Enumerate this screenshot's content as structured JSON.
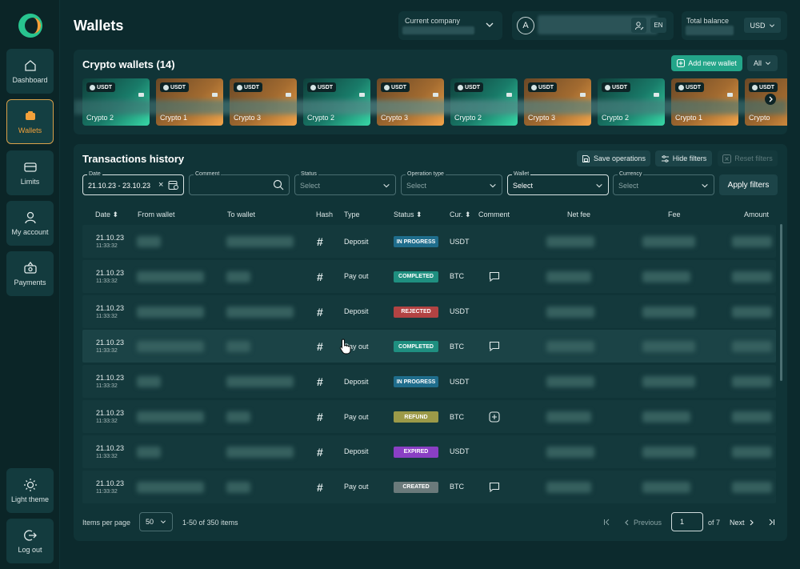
{
  "page": {
    "title": "Wallets"
  },
  "sidebar": {
    "items": [
      {
        "label": "Dashboard",
        "icon": "home-icon"
      },
      {
        "label": "Wallets",
        "icon": "wallet-icon",
        "active": true
      },
      {
        "label": "Limits",
        "icon": "card-icon"
      },
      {
        "label": "My account",
        "icon": "user-icon"
      },
      {
        "label": "Payments",
        "icon": "payments-icon"
      }
    ],
    "bottom": [
      {
        "label": "Light theme",
        "icon": "sun-icon"
      },
      {
        "label": "Log out",
        "icon": "logout-icon"
      }
    ]
  },
  "header": {
    "company_label": "Current company",
    "avatar_letter": "A",
    "lang": "EN",
    "balance_label": "Total balance",
    "currency": "USD"
  },
  "wallets": {
    "title": "Crypto wallets (14)",
    "add_label": "Add new wallet",
    "filter": "All",
    "cards": [
      {
        "badge": "USDT",
        "name": "Crypto 2",
        "color": "green"
      },
      {
        "badge": "USDT",
        "name": "Crypto 1",
        "color": "orange"
      },
      {
        "badge": "USDT",
        "name": "Crypto 3",
        "color": "orange"
      },
      {
        "badge": "USDT",
        "name": "Crypto 2",
        "color": "green"
      },
      {
        "badge": "USDT",
        "name": "Crypto 3",
        "color": "orange"
      },
      {
        "badge": "USDT",
        "name": "Crypto 2",
        "color": "green"
      },
      {
        "badge": "USDT",
        "name": "Crypto 3",
        "color": "orange"
      },
      {
        "badge": "USDT",
        "name": "Crypto 2",
        "color": "green"
      },
      {
        "badge": "USDT",
        "name": "Crypto 1",
        "color": "orange"
      },
      {
        "badge": "USDT",
        "name": "Crypto",
        "color": "orange"
      }
    ]
  },
  "transactions": {
    "title": "Transactions history",
    "save_label": "Save operations",
    "hide_label": "Hide filters",
    "reset_label": "Reset filters",
    "filters": {
      "date_label": "Date",
      "date_value": "21.10.23 - 23.10.23",
      "comment_label": "Comment",
      "status_label": "Status",
      "status_placeholder": "Select",
      "optype_label": "Operation type",
      "optype_placeholder": "Select",
      "wallet_label": "Wallet",
      "wallet_value": "Select",
      "currency_label": "Currency",
      "currency_placeholder": "Select",
      "apply_label": "Apply filters"
    },
    "columns": {
      "date": "Date",
      "from": "From wallet",
      "to": "To wallet",
      "hash": "Hash",
      "type": "Type",
      "status": "Status",
      "cur": "Cur.",
      "comment": "Comment",
      "net_fee": "Net fee",
      "fee": "Fee",
      "amount": "Amount"
    },
    "rows": [
      {
        "date": "21.10.23",
        "time": "11:33:32",
        "type": "Deposit",
        "status": "IN PROGRESS",
        "status_color": "#1f6d8c",
        "cur": "USDT",
        "comment": ""
      },
      {
        "date": "21.10.23",
        "time": "11:33:32",
        "type": "Pay out",
        "status": "COMPLETED",
        "status_color": "#1f8f80",
        "cur": "BTC",
        "comment": "message"
      },
      {
        "date": "21.10.23",
        "time": "11:33:32",
        "type": "Deposit",
        "status": "REJECTED",
        "status_color": "#b24343",
        "cur": "USDT",
        "comment": ""
      },
      {
        "date": "21.10.23",
        "time": "11:33:32",
        "type": "Pay out",
        "status": "COMPLETED",
        "status_color": "#1f8f80",
        "cur": "BTC",
        "comment": "message"
      },
      {
        "date": "21.10.23",
        "time": "11:33:32",
        "type": "Deposit",
        "status": "IN PROGRESS",
        "status_color": "#1f6d8c",
        "cur": "USDT",
        "comment": ""
      },
      {
        "date": "21.10.23",
        "time": "11:33:32",
        "type": "Pay out",
        "status": "REFUND",
        "status_color": "#9c9a48",
        "cur": "BTC",
        "comment": "add"
      },
      {
        "date": "21.10.23",
        "time": "11:33:32",
        "type": "Deposit",
        "status": "EXPIRED",
        "status_color": "#8a3fc4",
        "cur": "USDT",
        "comment": ""
      },
      {
        "date": "21.10.23",
        "time": "11:33:32",
        "type": "Pay out",
        "status": "CREATED",
        "status_color": "#6b7a7b",
        "cur": "BTC",
        "comment": "message"
      }
    ],
    "pagination": {
      "per_page_label": "Items per page",
      "per_page": "50",
      "range": "1-50 of 350 items",
      "previous": "Previous",
      "page": "1",
      "of": "of 7",
      "next": "Next"
    }
  }
}
